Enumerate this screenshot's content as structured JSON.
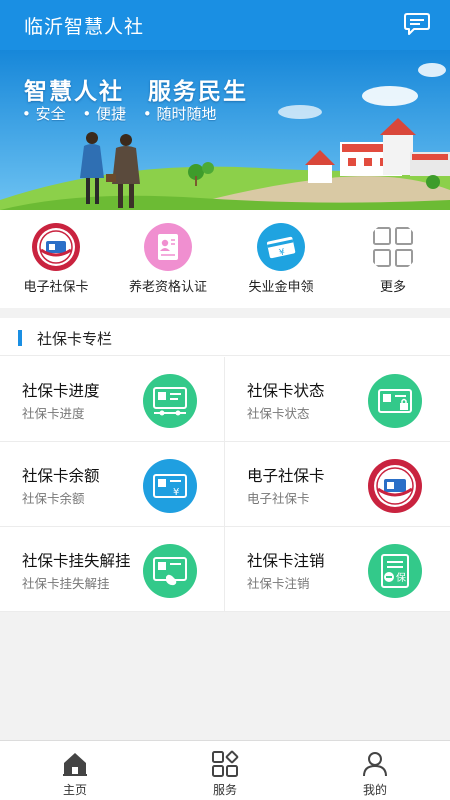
{
  "header": {
    "title": "临沂智慧人社",
    "message_icon": "chat-bubble-icon"
  },
  "banner": {
    "slogan_left": "智慧人社",
    "slogan_right": "服务民生",
    "features": [
      "安全",
      "便捷",
      "随时随地"
    ]
  },
  "quick": [
    {
      "label": "电子社保卡",
      "icon": "social-security-card-icon",
      "color": "#c9233f"
    },
    {
      "label": "养老资格认证",
      "icon": "id-document-icon",
      "color": "#f08fd0"
    },
    {
      "label": "失业金申领",
      "icon": "yuan-card-icon",
      "color": "#1fa3e0"
    },
    {
      "label": "更多",
      "icon": "grid-more-icon",
      "color": "#9a9a9a"
    }
  ],
  "section": {
    "title": "社保卡专栏",
    "items": [
      {
        "title": "社保卡进度",
        "subtitle": "社保卡进度",
        "icon": "card-progress-icon",
        "color": "#33c98a"
      },
      {
        "title": "社保卡状态",
        "subtitle": "社保卡状态",
        "icon": "card-status-icon",
        "color": "#33c98a"
      },
      {
        "title": "社保卡余额",
        "subtitle": "社保卡余额",
        "icon": "card-balance-icon",
        "color": "#1f9fe0"
      },
      {
        "title": "电子社保卡",
        "subtitle": "电子社保卡",
        "icon": "social-security-card-icon",
        "color": "#c9233f"
      },
      {
        "title": "社保卡挂失解挂",
        "subtitle": "社保卡挂失解挂",
        "icon": "card-report-loss-icon",
        "color": "#33c98a"
      },
      {
        "title": "社保卡注销",
        "subtitle": "社保卡注销",
        "icon": "card-cancel-icon",
        "color": "#33c98a"
      }
    ]
  },
  "tabbar": [
    {
      "label": "主页",
      "icon": "home-icon",
      "active": true
    },
    {
      "label": "服务",
      "icon": "services-grid-icon",
      "active": false
    },
    {
      "label": "我的",
      "icon": "profile-icon",
      "active": false
    }
  ],
  "colors": {
    "primary": "#1a8fe3",
    "accent_green": "#33c98a",
    "card_red": "#c9233f"
  }
}
